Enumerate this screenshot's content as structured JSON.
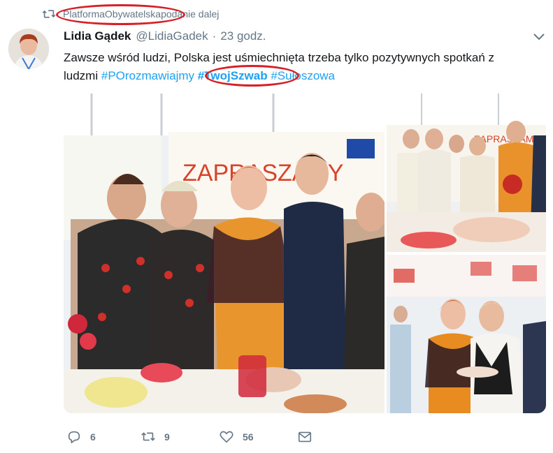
{
  "retweet": {
    "account": "PlatformaObywatelska",
    "suffix": " podanie dalej",
    "icon": "retweet-icon"
  },
  "tweet": {
    "author_name": "Lidia Gądek",
    "author_handle": "@LidiaGadek",
    "separator": "·",
    "timestamp": "23 godz.",
    "text_line1": "Zawsze wśród ludzi, Polska jest uśmiechnięta trzeba tylko pozytywnych spotkań z",
    "text_line2_start": "ludzmi ",
    "hashtag1": "#POrozmawiajmy",
    "hashtag2": "#TwojSzwab",
    "hashtag3": "#Sułoszowa",
    "menu_icon": "chevron-down-icon"
  },
  "media": {
    "banner_text_left": "ZAPRASZAMY",
    "banner_text_right": "ZAPRASZAMY"
  },
  "actions": {
    "reply_count": "6",
    "retweet_count": "9",
    "like_count": "56",
    "reply_icon": "reply-icon",
    "retweet_icon": "retweet-icon",
    "like_icon": "heart-icon",
    "dm_icon": "envelope-icon"
  },
  "colors": {
    "link": "#1da1f2",
    "muted": "#657786",
    "text": "#14171a",
    "annotation": "#d61f26"
  }
}
